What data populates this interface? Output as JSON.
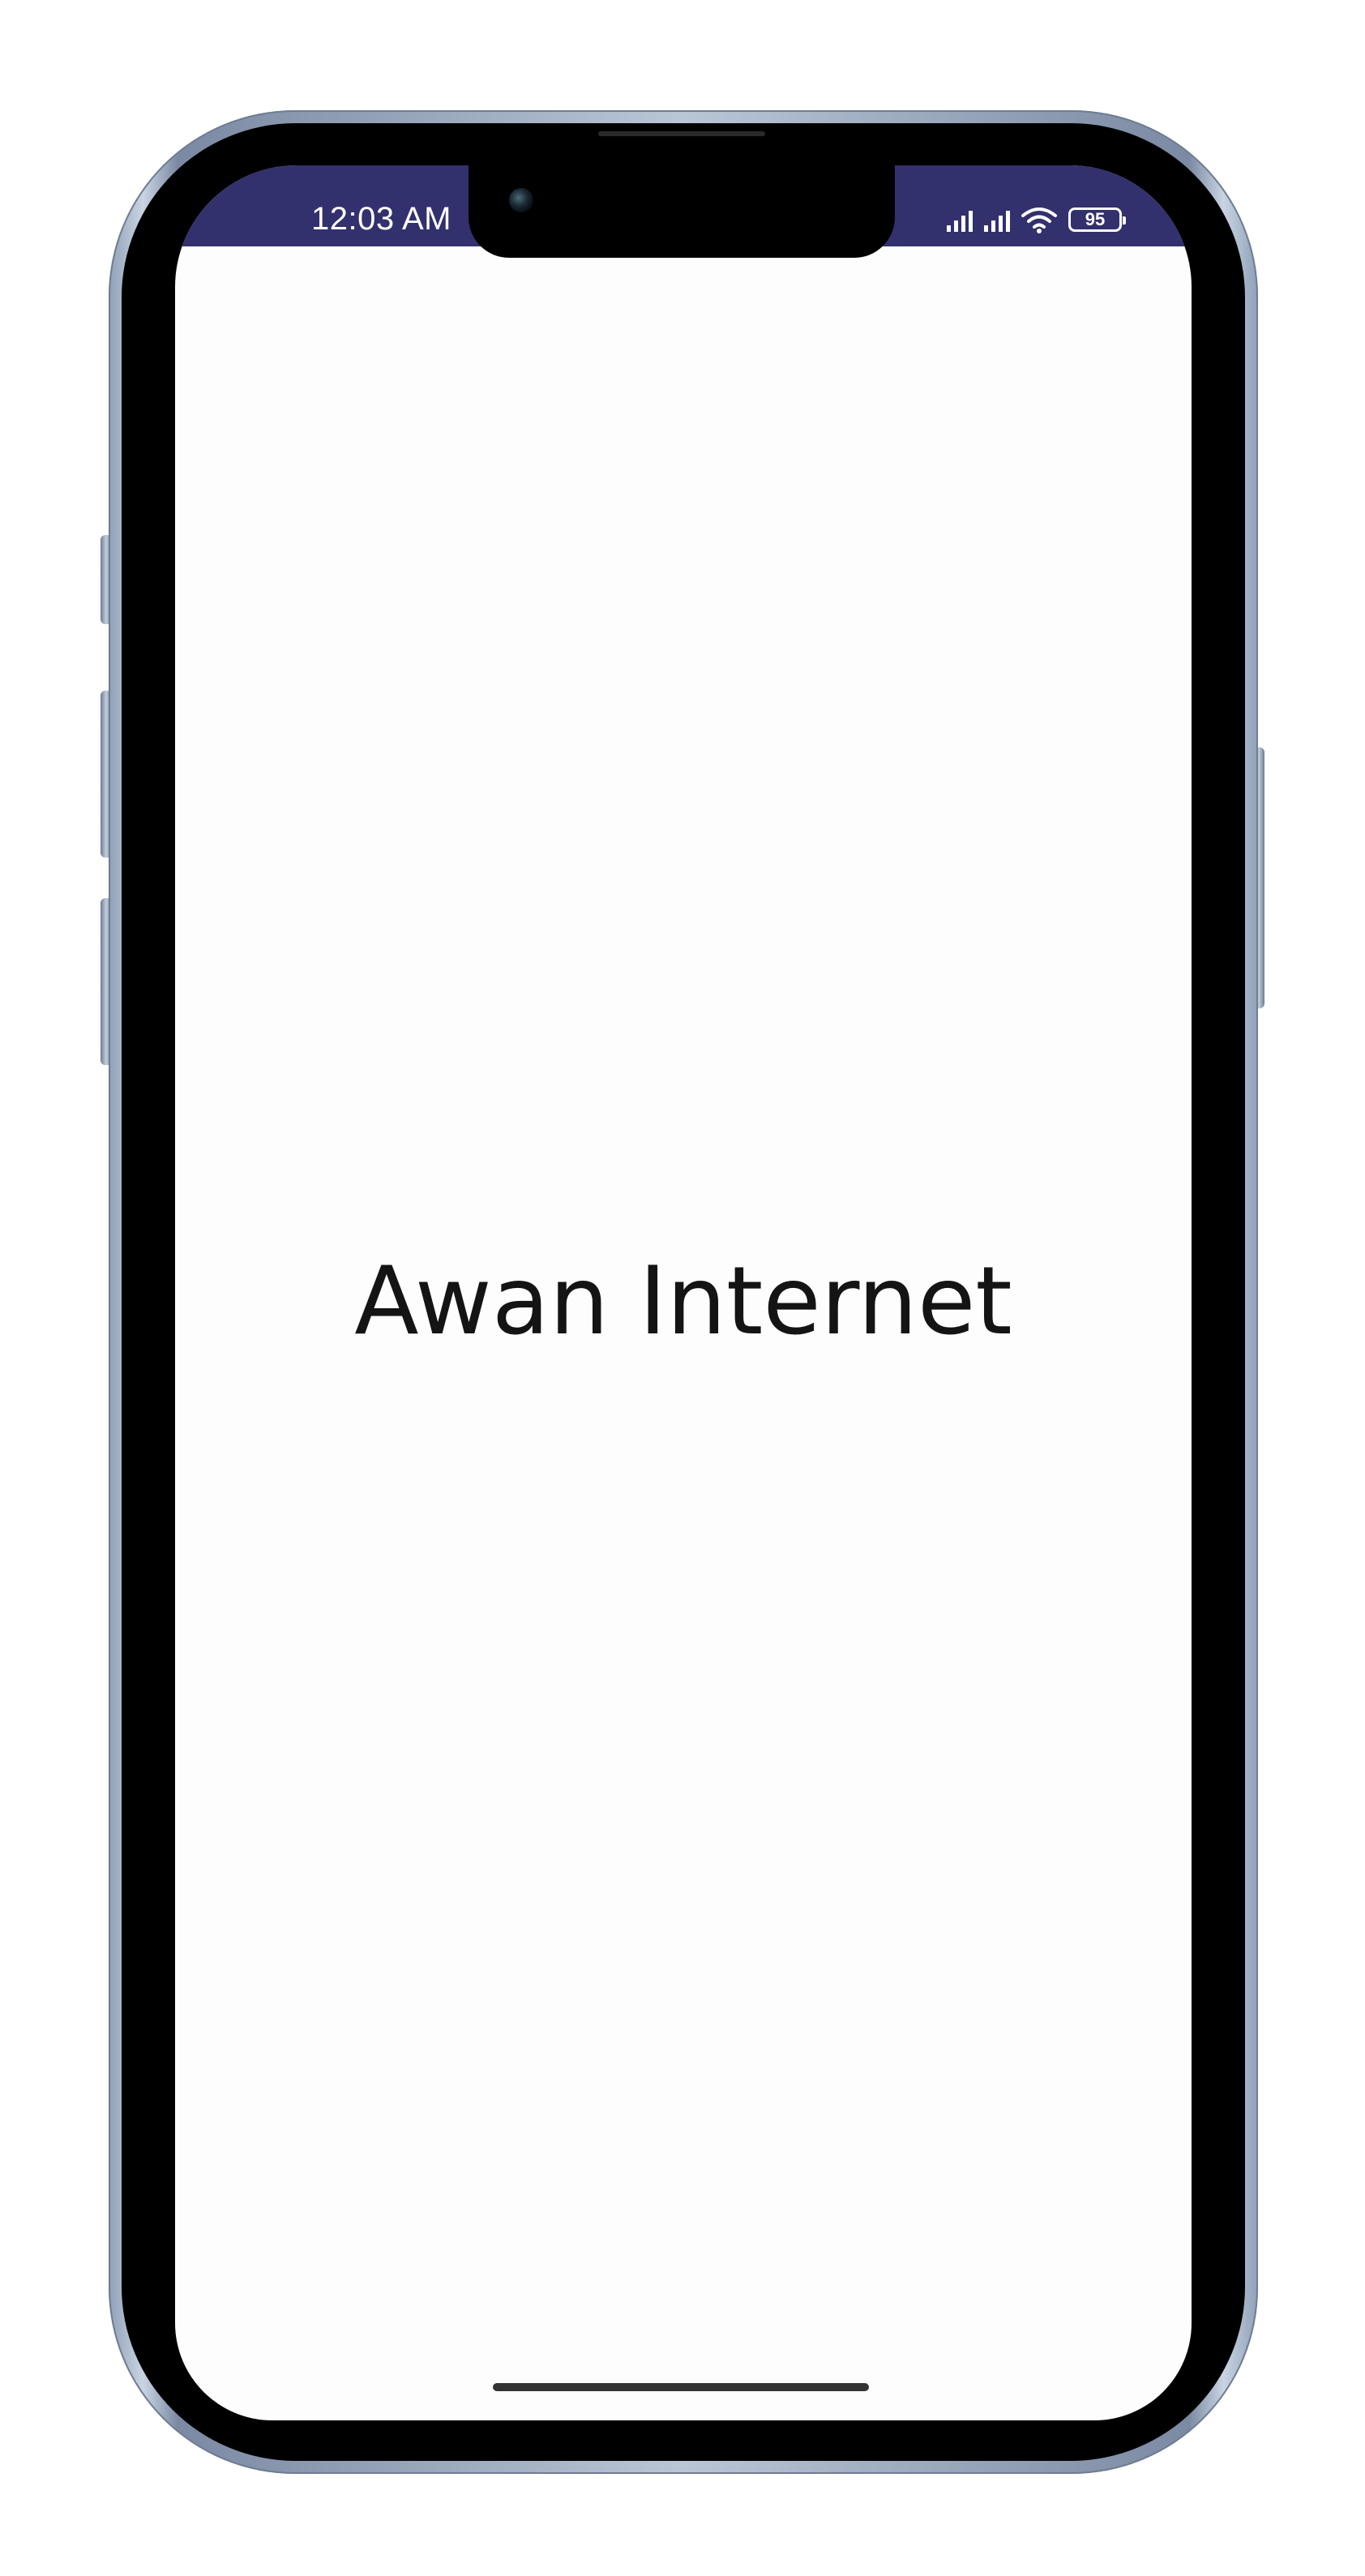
{
  "status_bar": {
    "time": "12:03 AM",
    "battery_level": "95",
    "background_color": "#33306e",
    "icons": [
      "signal-1-icon",
      "signal-2-icon",
      "wifi-icon",
      "battery-icon"
    ]
  },
  "screen": {
    "title": "Awan Internet",
    "background_color": "#fdfdfd"
  }
}
